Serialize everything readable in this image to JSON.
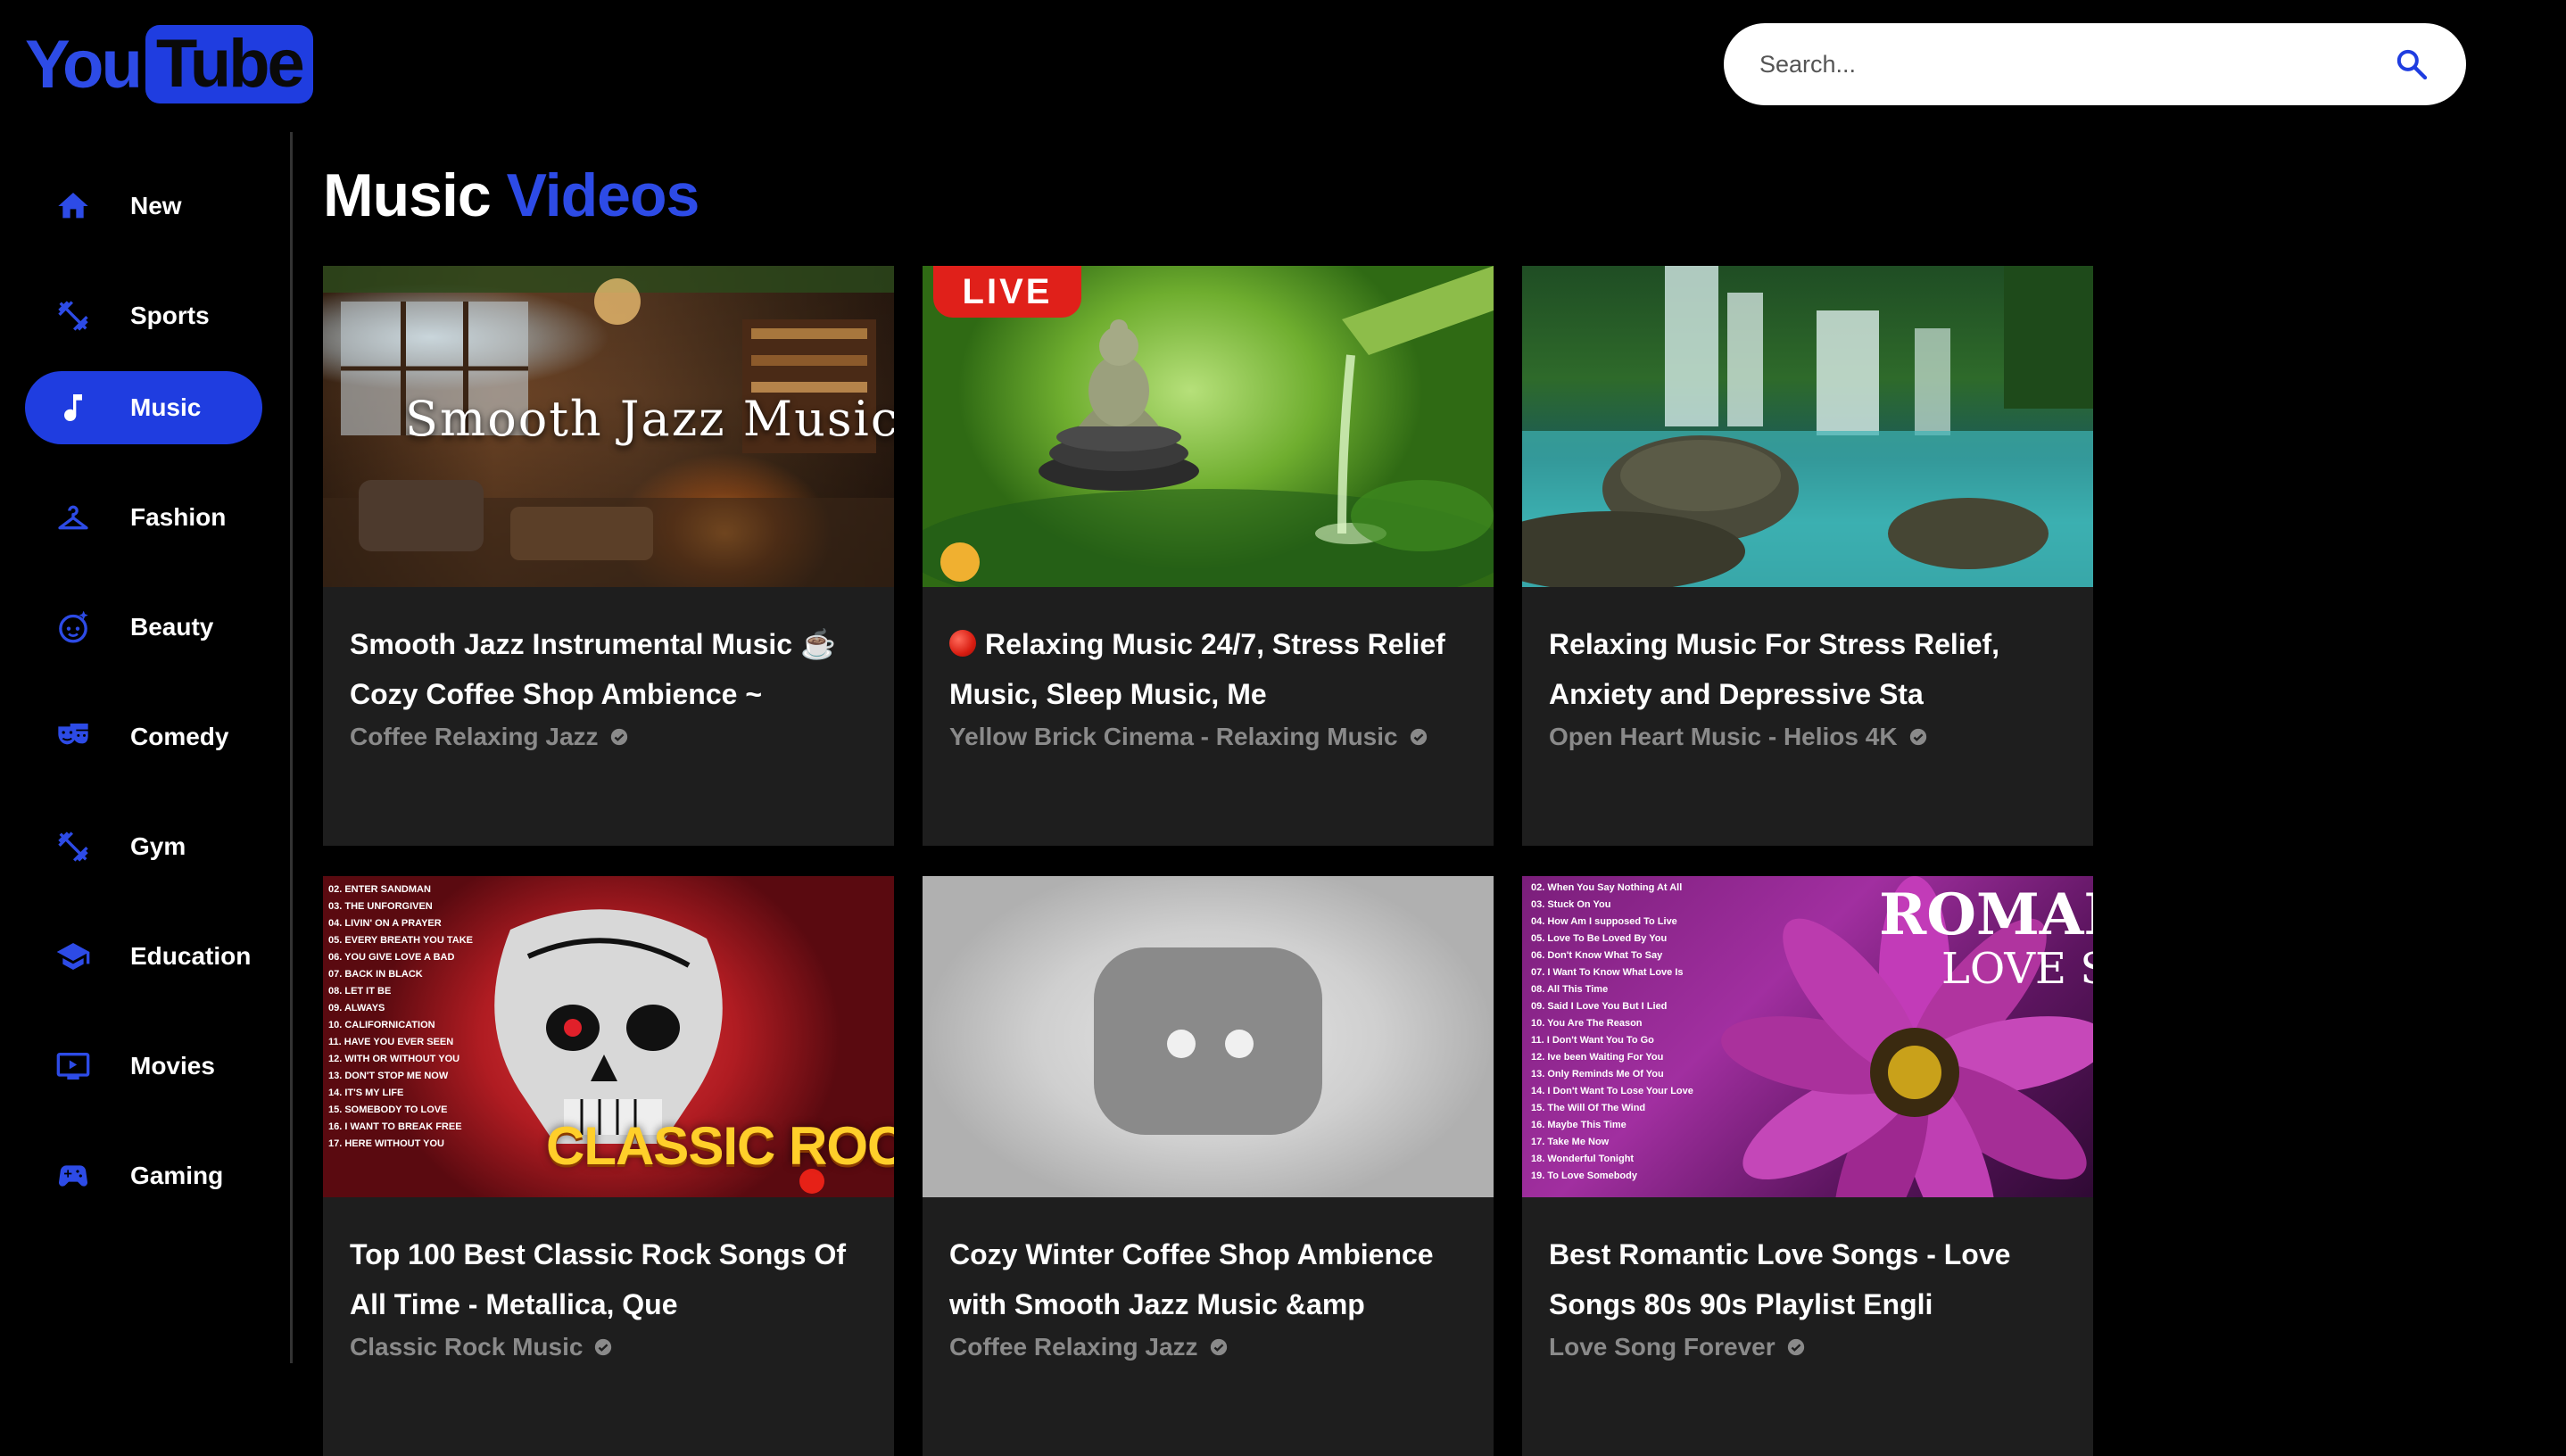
{
  "brand": {
    "logo_you": "You",
    "logo_tube": "Tube"
  },
  "search": {
    "placeholder": "Search..."
  },
  "sidebar": {
    "items": [
      {
        "label": "New",
        "icon": "home-icon",
        "active": false
      },
      {
        "label": "Sports",
        "icon": "dumbbell-icon",
        "active": false
      },
      {
        "label": "Music",
        "icon": "music-note-icon",
        "active": true
      },
      {
        "label": "Fashion",
        "icon": "hanger-icon",
        "active": false
      },
      {
        "label": "Beauty",
        "icon": "face-retouching-icon",
        "active": false
      },
      {
        "label": "Comedy",
        "icon": "theater-masks-icon",
        "active": false
      },
      {
        "label": "Gym",
        "icon": "dumbbell-icon",
        "active": false
      },
      {
        "label": "Education",
        "icon": "graduation-cap-icon",
        "active": false
      },
      {
        "label": "Movies",
        "icon": "tv-icon",
        "active": false
      },
      {
        "label": "Gaming",
        "icon": "gamepad-icon",
        "active": false
      }
    ]
  },
  "main": {
    "title_primary": "Music",
    "title_accent": "Videos",
    "videos": [
      {
        "title": "Smooth Jazz Instrumental Music ☕ Cozy Coffee Shop Ambience ~",
        "channel": "Coffee Relaxing Jazz",
        "thumb_text": "Smooth Jazz Music"
      },
      {
        "title": "Relaxing Music 24/7, Stress Relief Music, Sleep Music, Me",
        "channel": "Yellow Brick Cinema - Relaxing Music",
        "thumb_badge": "LIVE"
      },
      {
        "title": "Relaxing Music For Stress Relief, Anxiety and Depressive Sta",
        "channel": "Open Heart Music - Helios 4K"
      },
      {
        "title": "Top 100 Best Classic Rock Songs Of All Time - Metallica, Que",
        "channel": "Classic Rock Music",
        "thumb_text": "CLASSIC ROCK"
      },
      {
        "title": "Cozy Winter Coffee Shop Ambience with Smooth Jazz Music &amp",
        "channel": "Coffee Relaxing Jazz"
      },
      {
        "title": "Best Romantic Love Songs - Love Songs 80s 90s Playlist Engli",
        "channel": "Love Song Forever",
        "thumb_text_1": "ROMANTI",
        "thumb_text_2": "LOVE SO"
      }
    ]
  },
  "colors": {
    "accent": "#1f3de0",
    "card_bg": "#1e1e1e",
    "channel_text": "#8a8a8a"
  }
}
